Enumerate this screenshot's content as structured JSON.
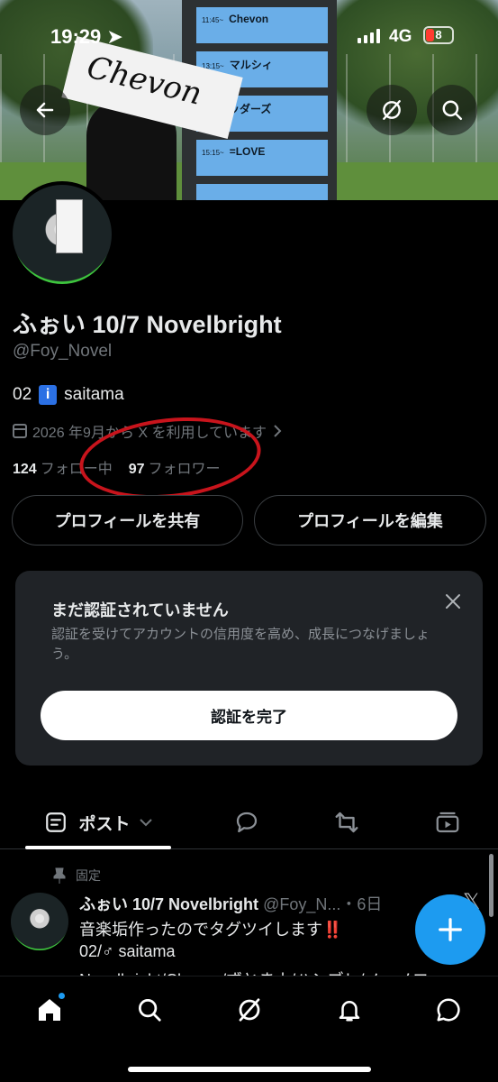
{
  "status_bar": {
    "time": "19:29",
    "network": "4G",
    "battery": "8"
  },
  "banner": {
    "slots": [
      {
        "time": "11:45~",
        "name": "Chevon"
      },
      {
        "time": "13:15~",
        "name": "マルシィ"
      },
      {
        "time": "",
        "name": "ブレッダーズ"
      },
      {
        "time": "15:15~",
        "name": "=LOVE"
      },
      {
        "time": "",
        "name": ""
      }
    ],
    "towel_text": "Chevon"
  },
  "profile": {
    "name": "ふぉい 10/7 Novelbright",
    "handle": "@Foy_Novel",
    "bio_prefix": "02",
    "bio_suffix": "saitama",
    "info_glyph": "i",
    "joined": "2026 年9月から X を利用しています",
    "following_count": "124",
    "following_label": "フォロー中",
    "followers_count": "97",
    "followers_label": "フォロワー",
    "share_button": "プロフィールを共有",
    "edit_button": "プロフィールを編集"
  },
  "verify_card": {
    "title": "まだ認証されていません",
    "description": "認証を受けてアカウントの信用度を高め、成長につなげましょう。",
    "button": "認証を完了"
  },
  "tabs": {
    "active_label": "ポスト"
  },
  "post": {
    "pinned_label": "固定",
    "author": "ふぉい 10/7 Novelbright",
    "handle_time": "@Foy_N...・6日",
    "line1": "音楽垢作ったのでタグツイします",
    "line1_mark": "‼️",
    "line2": "02/♂ saitama",
    "line3": "Novelbright/Chevon/ずとまよ/ハンブレ/ノーメロ",
    "x_glyph": "𝕏"
  },
  "colors": {
    "accent": "#1d9bf0",
    "annotation_circle": "#c8141c",
    "card_bg": "#202327"
  },
  "icons": [
    "back-arrow-icon",
    "grok-icon",
    "search-icon",
    "calendar-icon",
    "chevron-right-icon",
    "close-icon",
    "post-list-icon",
    "reply-icon",
    "repost-icon",
    "media-icon",
    "pin-icon",
    "plus-icon",
    "home-icon",
    "explore-icon",
    "notifications-icon",
    "messages-icon"
  ]
}
